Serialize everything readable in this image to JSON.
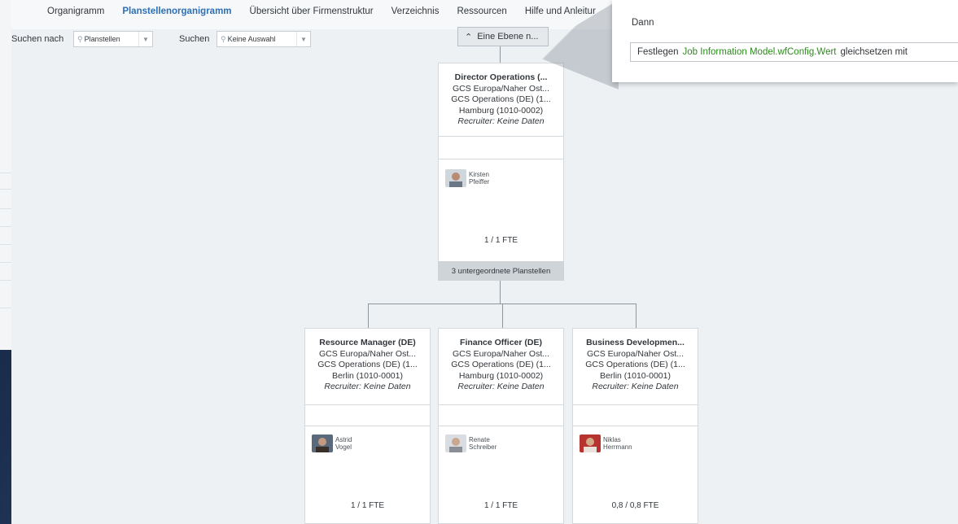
{
  "nav": {
    "tabs": [
      "Organigramm",
      "Planstellenorganigramm",
      "Übersicht über Firmenstruktur",
      "Verzeichnis",
      "Ressourcen",
      "Hilfe und Anleitur"
    ],
    "active_index": 1
  },
  "search": {
    "search_by_label": "Suchen nach",
    "search_by_value": "Planstellen",
    "search_label": "Suchen",
    "search_value": "Keine Auswahl"
  },
  "up_button": {
    "label": "Eine Ebene n..."
  },
  "popup": {
    "then_label": "Dann",
    "rule_prefix": "Festlegen",
    "rule_field": "Job Information Model.wfConfig.Wert",
    "rule_suffix": "gleichsetzen mit"
  },
  "root": {
    "title": "Director Operations (...",
    "lines": [
      "GCS Europa/Naher Ost...",
      "GCS Operations (DE) (1...",
      "Hamburg (1010-0002)"
    ],
    "recruiter": "Recruiter: Keine Daten",
    "person_first": "Kirsten",
    "person_last": "Pfeiffer",
    "fte": "1 / 1 FTE",
    "subordinates": "3 untergeordnete Planstellen"
  },
  "children": [
    {
      "title": "Resource Manager (DE)",
      "lines": [
        "GCS Europa/Naher Ost...",
        "GCS Operations (DE) (1...",
        "Berlin (1010-0001)"
      ],
      "recruiter": "Recruiter: Keine Daten",
      "person_first": "Astrid",
      "person_last": "Vogel",
      "fte": "1 / 1 FTE"
    },
    {
      "title": "Finance Officer (DE)",
      "lines": [
        "GCS Europa/Naher Ost...",
        "GCS Operations (DE) (1...",
        "Hamburg (1010-0002)"
      ],
      "recruiter": "Recruiter: Keine Daten",
      "person_first": "Renate",
      "person_last": "Schreiber",
      "fte": "1 / 1 FTE"
    },
    {
      "title": "Business Developmen...",
      "lines": [
        "GCS Europa/Naher Ost...",
        "GCS Operations (DE) (1...",
        "Berlin (1010-0001)"
      ],
      "recruiter": "Recruiter: Keine Daten",
      "person_first": "Niklas",
      "person_last": "Herrmann",
      "fte": "0,8 / 0,8 FTE"
    }
  ],
  "colors": {
    "accent": "#2b6fb6",
    "rule_field": "#2f8a1f"
  }
}
